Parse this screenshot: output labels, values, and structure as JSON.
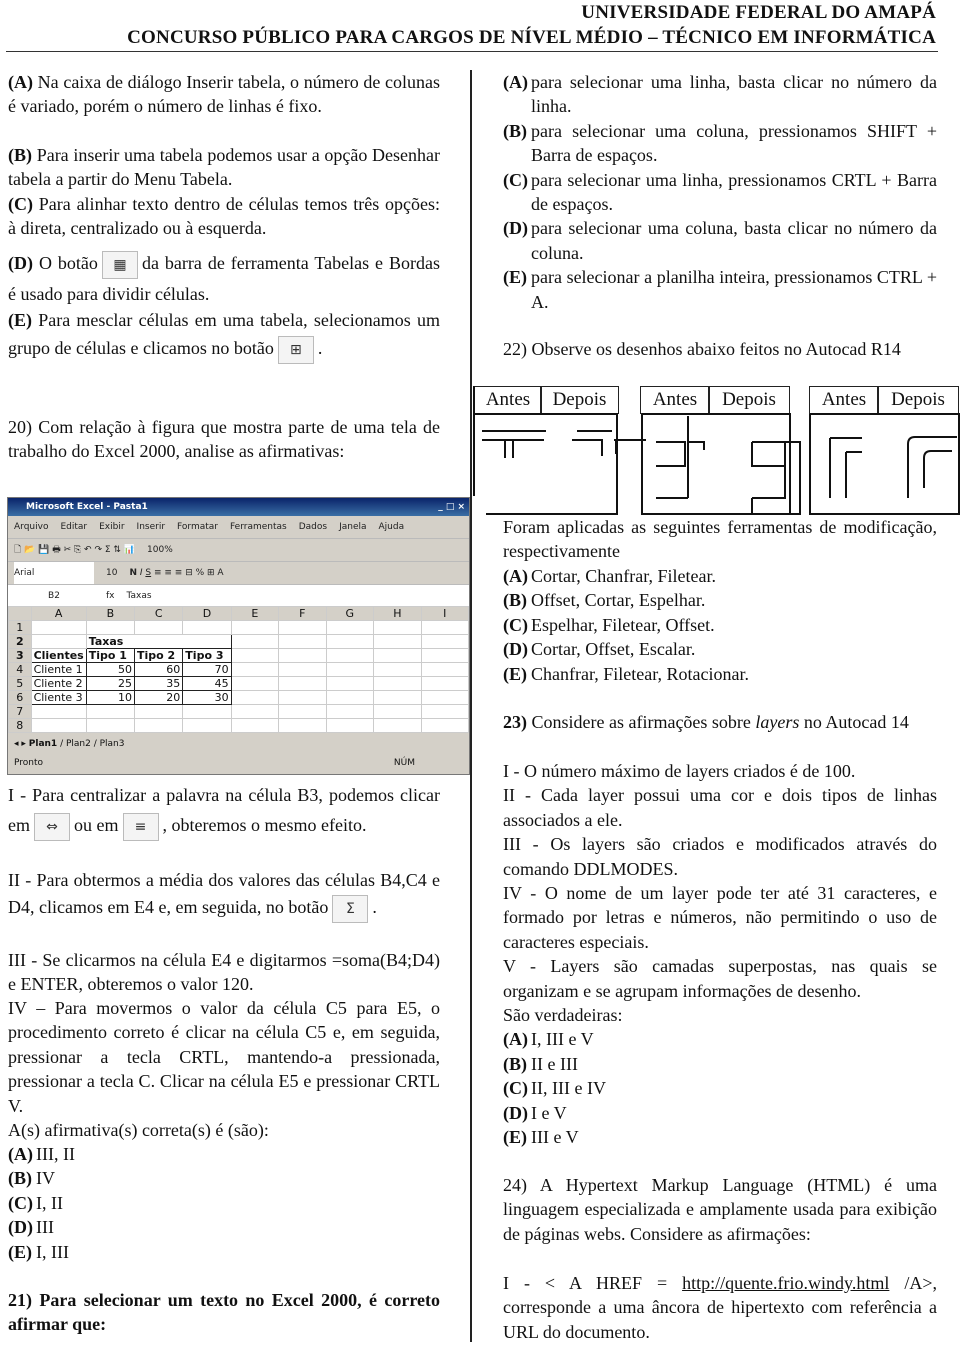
{
  "header": {
    "line1": "UNIVERSIDADE FEDERAL DO AMAPÁ",
    "line2": "CONCURSO PÚBLICO PARA CARGOS DE NÍVEL MÉDIO – TÉCNICO EM INFORMÁTICA"
  },
  "q19": {
    "options": [
      {
        "letter": "(A)",
        "text": "Na caixa de diálogo Inserir tabela, o número de colunas é variado, porém o número de linhas é fixo."
      },
      {
        "letter": "(B)",
        "text": "Para inserir uma tabela podemos usar a opção Desenhar tabela a partir do Menu Tabela."
      },
      {
        "letter": "(C)",
        "text": "Para alinhar texto dentro de células temos três opções: à direta, centralizado ou à esquerda."
      },
      {
        "letter": "(D)",
        "text_before": "O botão",
        "text_after": "da barra de ferramenta Tabelas e Bordas é usado para dividir células.",
        "icon": "split-cells-icon"
      },
      {
        "letter": "(E)",
        "text_before": "Para mesclar células em uma tabela, selecionamos um grupo de células e clicamos no botão",
        "text_after": ".",
        "icon": "merge-cells-icon"
      }
    ]
  },
  "q20": {
    "stem": "20) Com relação à figura que mostra parte de uma tela de trabalho do Excel 2000, analise as afirmativas:",
    "excel": {
      "title": "Microsoft Excel - Pasta1",
      "menu": [
        "Arquivo",
        "Editar",
        "Exibir",
        "Inserir",
        "Formatar",
        "Ferramentas",
        "Dados",
        "Janela",
        "Ajuda"
      ],
      "font": "Arial",
      "size": "10",
      "zoom": "100%",
      "cell_ref": "B2",
      "formula": "Taxas",
      "columns": [
        "A",
        "B",
        "C",
        "D",
        "E",
        "F",
        "G",
        "H",
        "I"
      ],
      "rows": [
        [
          "1",
          "",
          "",
          "",
          "",
          "",
          "",
          "",
          "",
          ""
        ],
        [
          "2",
          "",
          "Taxas",
          "",
          "",
          "",
          "",
          "",
          "",
          ""
        ],
        [
          "3",
          "Clientes",
          "Tipo 1",
          "Tipo 2",
          "Tipo 3",
          "",
          "",
          "",
          "",
          ""
        ],
        [
          "4",
          "Cliente 1",
          "50",
          "60",
          "70",
          "",
          "",
          "",
          "",
          ""
        ],
        [
          "5",
          "Cliente 2",
          "25",
          "35",
          "45",
          "",
          "",
          "",
          "",
          ""
        ],
        [
          "6",
          "Cliente 3",
          "10",
          "20",
          "30",
          "",
          "",
          "",
          "",
          ""
        ],
        [
          "7",
          "",
          "",
          "",
          "",
          "",
          "",
          "",
          "",
          ""
        ],
        [
          "8",
          "",
          "",
          "",
          "",
          "",
          "",
          "",
          "",
          ""
        ]
      ],
      "sheets": [
        "Plan1",
        "Plan2",
        "Plan3"
      ],
      "status": "Pronto",
      "num": "NÚM"
    },
    "items": {
      "i_a": "I - Para centralizar a palavra na célula B3, podemos clicar em",
      "i_b": "ou em",
      "i_c": ", obteremos o mesmo efeito.",
      "ii": "II - Para obtermos a média dos valores das células B4,C4 e D4, clicamos em E4 e, em seguida, no botão",
      "ii_end": ".",
      "iii": "III - Se clicarmos na célula E4 e digitarmos =soma(B4;D4) e ENTER, obteremos o valor 120.",
      "iv": "IV – Para movermos o valor da célula C5 para E5, o procedimento correto é clicar na célula C5 e, em seguida, pressionar a tecla CRTL, mantendo-a pressionada, pressionar a tecla C. Clicar na célula E5 e pressionar CRTL V."
    },
    "question": "A(s) afirmativa(s) correta(s) é (são):",
    "options": [
      {
        "letter": "(A)",
        "text": "III, II"
      },
      {
        "letter": "(B)",
        "text": "IV"
      },
      {
        "letter": "(C)",
        "text": "I, II"
      },
      {
        "letter": "(D)",
        "text": "III"
      },
      {
        "letter": "(E)",
        "text": "I, III"
      }
    ]
  },
  "q21": {
    "stem": "21) Para selecionar um texto no Excel 2000, é correto afirmar que:",
    "options": [
      {
        "letter": "(A)",
        "text": "para selecionar uma linha, basta clicar no número da linha."
      },
      {
        "letter": "(B)",
        "text": "para selecionar uma coluna, pressionamos SHIFT + Barra de espaços."
      },
      {
        "letter": "(C)",
        "text": "para selecionar uma linha, pressionamos CRTL + Barra de espaços."
      },
      {
        "letter": "(D)",
        "text": "para selecionar uma coluna, basta clicar no número da coluna."
      },
      {
        "letter": "(E)",
        "text": "para selecionar a planilha inteira, pressionamos CTRL + A."
      }
    ]
  },
  "q22": {
    "stem": "22) Observe os desenhos abaixo feitos no Autocad R14",
    "headers": [
      "Antes",
      "Depois",
      "Antes",
      "Depois",
      "Antes",
      "Depois"
    ],
    "text": "Foram aplicadas as seguintes ferramentas de modificação, respectivamente",
    "options": [
      {
        "letter": "(A)",
        "text": "Cortar, Chanfrar, Filetear."
      },
      {
        "letter": "(B)",
        "text": "Offset, Cortar, Espelhar."
      },
      {
        "letter": "(C)",
        "text": "Espelhar, Filetear, Offset."
      },
      {
        "letter": "(D)",
        "text": "Cortar, Offset, Escalar."
      },
      {
        "letter": "(E)",
        "text": "Chanfrar, Filetear, Rotacionar."
      }
    ]
  },
  "q23": {
    "stem_num": "23)",
    "stem_a": "Considere as afirmações sobre",
    "stem_i": "layers",
    "stem_b": "no Autocad 14",
    "items": [
      "I - O número máximo de layers criados é de 100.",
      "II - Cada layer possui uma cor e dois tipos de linhas associados a ele.",
      "III - Os layers são criados e modificados através do comando DDLMODES.",
      "IV - O nome de um layer pode ter até 31 caracteres, e formado por letras e números, não permitindo o uso de caracteres especiais.",
      "V - Layers são camadas superpostas, nas quais se organizam e se agrupam informações de desenho."
    ],
    "question": "São verdadeiras:",
    "options": [
      {
        "letter": "(A)",
        "text": "I, III e V"
      },
      {
        "letter": "(B)",
        "text": "II e III"
      },
      {
        "letter": "(C)",
        "text": "II, III e IV"
      },
      {
        "letter": "(D)",
        "text": "I e V"
      },
      {
        "letter": "(E)",
        "text": "III e V"
      }
    ]
  },
  "q24": {
    "stem": "24) A Hypertext Markup Language (HTML) é uma linguagem especializada e amplamente usada para exibição de páginas webs. Considere as afirmações:",
    "item_a": "I - < A HREF = ",
    "link": "http://quente.frio.windy.html",
    "item_b": " /A>, corresponde a uma âncora de hipertexto com referência a URL do documento."
  }
}
